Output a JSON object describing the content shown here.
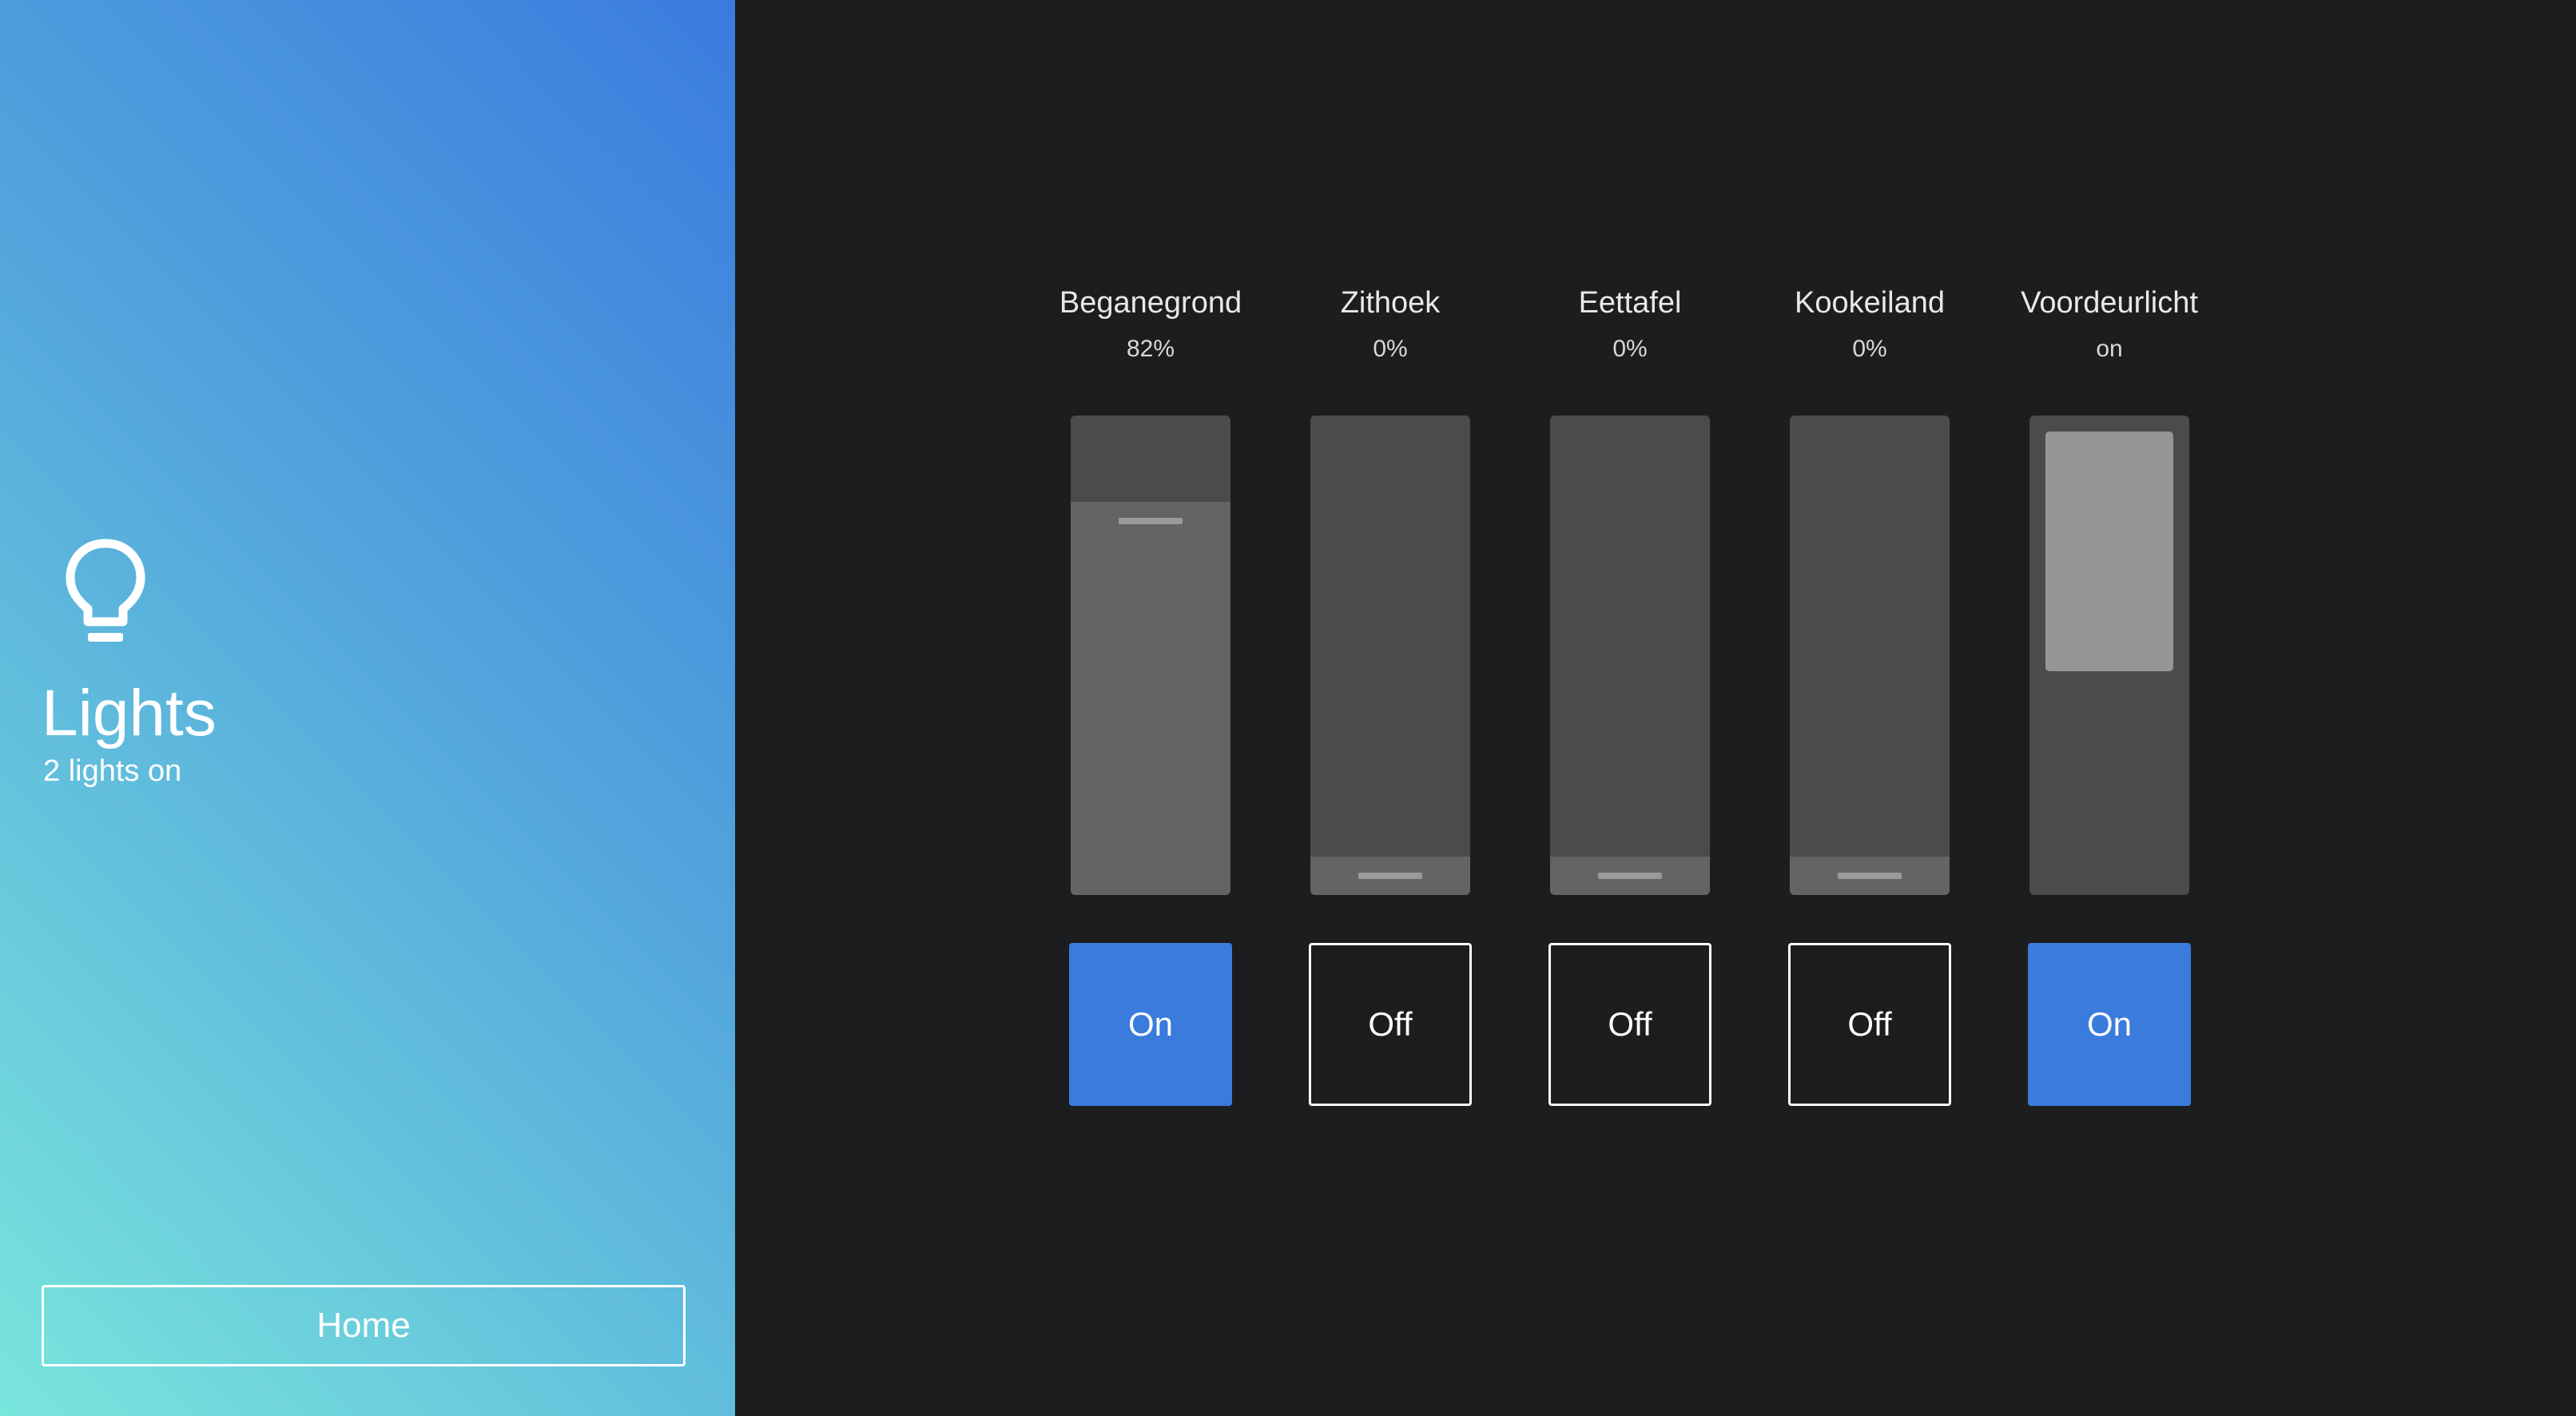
{
  "sidebar": {
    "icon": "lightbulb-icon",
    "title": "Lights",
    "subtitle": "2 lights on",
    "home_label": "Home"
  },
  "colors": {
    "accent": "#3a7bdc",
    "background": "#1c1d1f",
    "slider_track": "#4b4b4b",
    "slider_fill": "#646464"
  },
  "lights": [
    {
      "name": "Beganegrond",
      "value": "82%",
      "level": 0.82,
      "type": "dimmer",
      "button_label": "On",
      "state": "on"
    },
    {
      "name": "Zithoek",
      "value": "0%",
      "level": 0,
      "type": "dimmer",
      "button_label": "Off",
      "state": "off"
    },
    {
      "name": "Eettafel",
      "value": "0%",
      "level": 0,
      "type": "dimmer",
      "button_label": "Off",
      "state": "off"
    },
    {
      "name": "Kookeiland",
      "value": "0%",
      "level": 0,
      "type": "dimmer",
      "button_label": "Off",
      "state": "off"
    },
    {
      "name": "Voordeurlicht",
      "value": "on",
      "level": 1,
      "type": "switch",
      "button_label": "On",
      "state": "on"
    }
  ]
}
